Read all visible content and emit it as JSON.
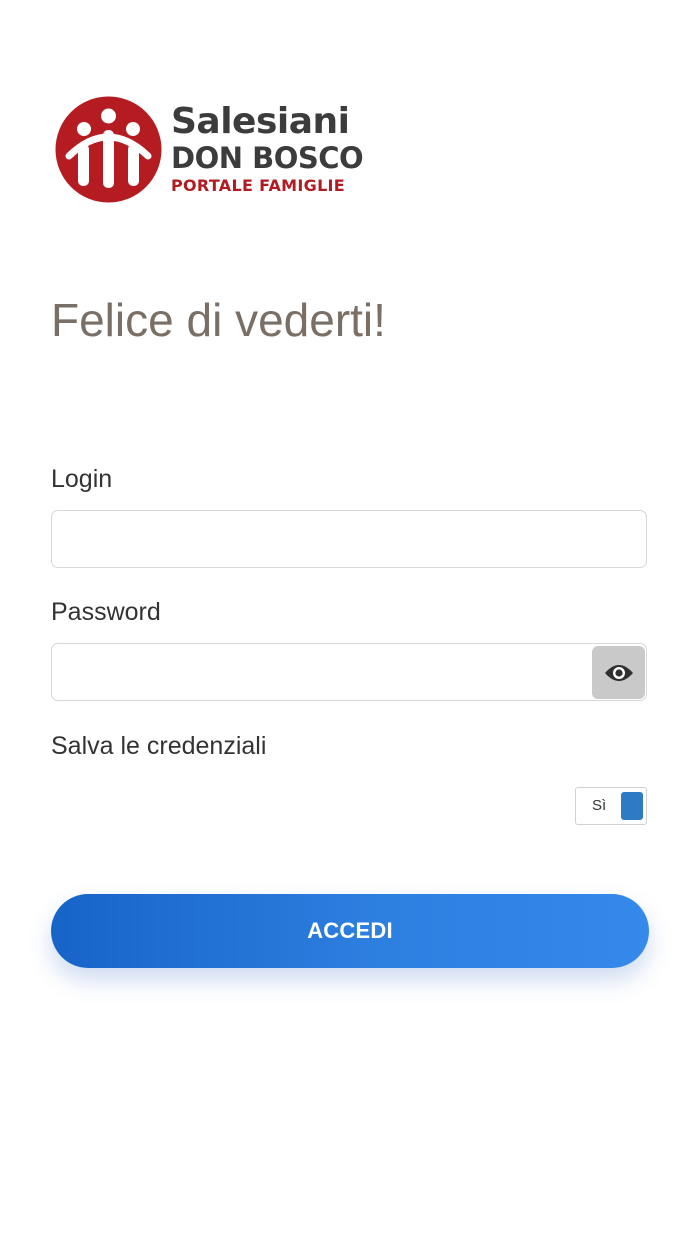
{
  "logo": {
    "line1": "Salesiani",
    "line2": "DON BOSCO",
    "line3": "PORTALE FAMIGLIE",
    "mark_color": "#b51c22"
  },
  "greeting": "Felice di vederti!",
  "form": {
    "login_label": "Login",
    "login_value": "",
    "password_label": "Password",
    "password_value": "",
    "show_password_icon": "eye-icon",
    "save_credentials_label": "Salva le credenziali",
    "save_toggle_label": "Sì",
    "save_toggle_on": true,
    "submit_label": "ACCEDI"
  },
  "colors": {
    "accent": "#2d7fe0",
    "toggle_on": "#2f7ac4",
    "greeting": "#7a6f66",
    "brand_red": "#b01c22"
  }
}
